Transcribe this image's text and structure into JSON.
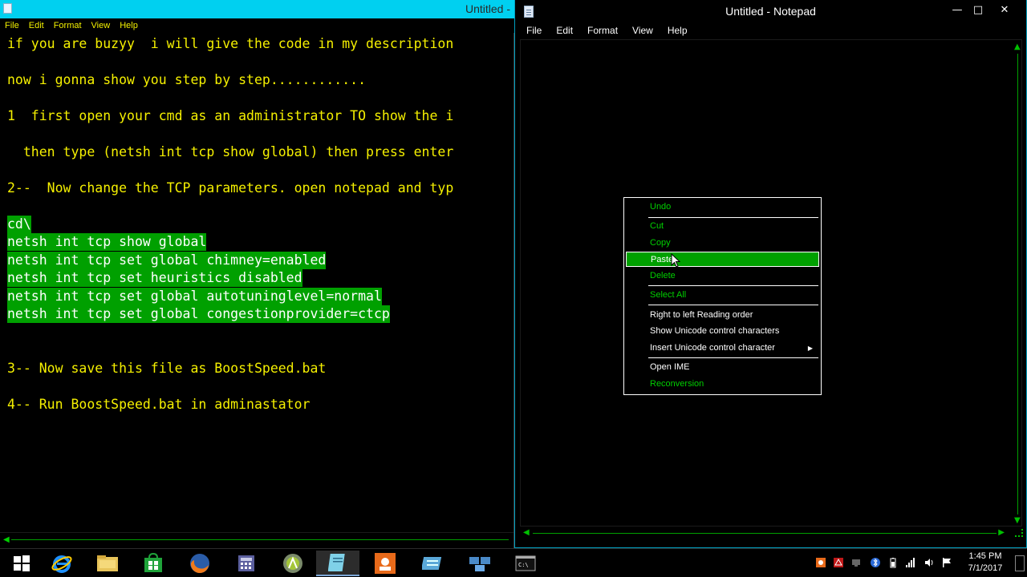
{
  "left_window": {
    "title": "Untitled -",
    "menu": [
      "File",
      "Edit",
      "Format",
      "View",
      "Help"
    ],
    "lines": [
      "if you are buzyy  i will give the code in my description",
      "now i gonna show you step by step............",
      "1  first open your cmd as an administrator TO show the i",
      "  then type (netsh int tcp show global) then press enter",
      "2--  Now change the TCP parameters. open notepad and typ",
      "cd\\",
      "netsh int tcp show global",
      "netsh int tcp set global chimney=enabled",
      "netsh int tcp set heuristics disabled",
      "netsh int tcp set global autotuninglevel=normal",
      "netsh int tcp set global congestionprovider=ctcp",
      "3-- Now save this file as BoostSpeed.bat",
      "4-- Run BoostSpeed.bat in adminastator"
    ]
  },
  "right_window": {
    "title": "Untitled - Notepad",
    "menu": [
      "File",
      "Edit",
      "Format",
      "View",
      "Help"
    ],
    "controls": {
      "minimize": "—",
      "maximize": "□",
      "close": "✕"
    }
  },
  "context_menu": {
    "items": [
      {
        "label": "Undo",
        "style": "g"
      },
      {
        "label": "Cut",
        "style": "g"
      },
      {
        "label": "Copy",
        "style": "g"
      },
      {
        "label": "Paste",
        "style": "hl"
      },
      {
        "label": "Delete",
        "style": "g"
      },
      {
        "label": "Select All",
        "style": "g"
      },
      {
        "label": "Right to left Reading order",
        "style": "w"
      },
      {
        "label": "Show Unicode control characters",
        "style": "w"
      },
      {
        "label": "Insert Unicode control character",
        "style": "w"
      },
      {
        "label": "Open IME",
        "style": "w"
      },
      {
        "label": "Reconversion",
        "style": "g"
      }
    ]
  },
  "taskbar": {
    "apps": [
      "start-icon",
      "internet-explorer-icon",
      "file-explorer-icon",
      "store-icon",
      "firefox-icon",
      "calculator-icon",
      "android-icon",
      "notepad-icon",
      "app-orange-icon",
      "app-blue-icon",
      "network-app-icon",
      "cmd-icon"
    ],
    "time": "1:45 PM",
    "date": "7/1/2017"
  },
  "colors": {
    "left_text": "#f5f000",
    "selection": "#00a000",
    "title_bar": "#00d0f0",
    "menu_green": "#00d000"
  }
}
